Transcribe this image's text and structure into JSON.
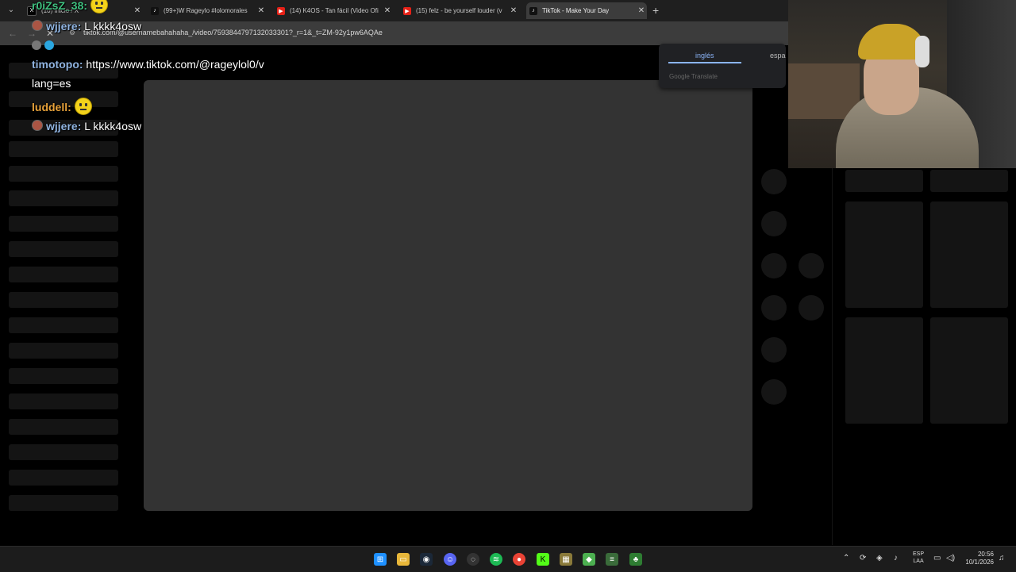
{
  "browser": {
    "tabs": [
      {
        "title": "(10) Inicio / X",
        "favicon": "x-logo-icon"
      },
      {
        "title": "(99+)W Rageylo #lolomorales",
        "favicon": "tiktok-icon"
      },
      {
        "title": "(14) K4OS - Tan fácil (Video Ofi",
        "favicon": "youtube-icon"
      },
      {
        "title": "(15) felz - be yourself louder (v",
        "favicon": "youtube-icon"
      },
      {
        "title": "TikTok - Make Your Day",
        "favicon": "tiktok-icon"
      }
    ],
    "new_tab_label": "+",
    "url": "tiktok.com/@usernamebahahaha_/video/7593844797132033301?_r=1&_t=ZM-92y1pw6AQAe"
  },
  "translate_popup": {
    "lang_from": "inglés",
    "lang_to": "españ",
    "brand": "Google Translate"
  },
  "chat": [
    {
      "user": "r0iZsZ_38:",
      "message": "",
      "user_color": "#3fbf7f",
      "emote": true
    },
    {
      "user": "wjjere:",
      "message": " L kkkk4osw",
      "user_color": "#8fb3e0",
      "badge": true
    },
    {
      "user": "timotopo:",
      "message": " https://www.tiktok.com/@rageylol0/v",
      "user_color": "#8fb3e0"
    },
    {
      "user": "",
      "message": "lang=es",
      "user_color": "#ffffff"
    },
    {
      "user": "luddell:",
      "message": " ",
      "user_color": "#e8a23a",
      "emote": true
    },
    {
      "user": "wjjere:",
      "message": " L kkkk4osw",
      "user_color": "#8fb3e0",
      "badge": true
    }
  ],
  "taskbar": {
    "language": "ESP",
    "region": "LAA",
    "time": "20:56",
    "date": "10/1/2026"
  },
  "colors": {
    "page_bg": "#000000",
    "video_placeholder": "#333333",
    "accent_translate": "#8ab4f8"
  }
}
